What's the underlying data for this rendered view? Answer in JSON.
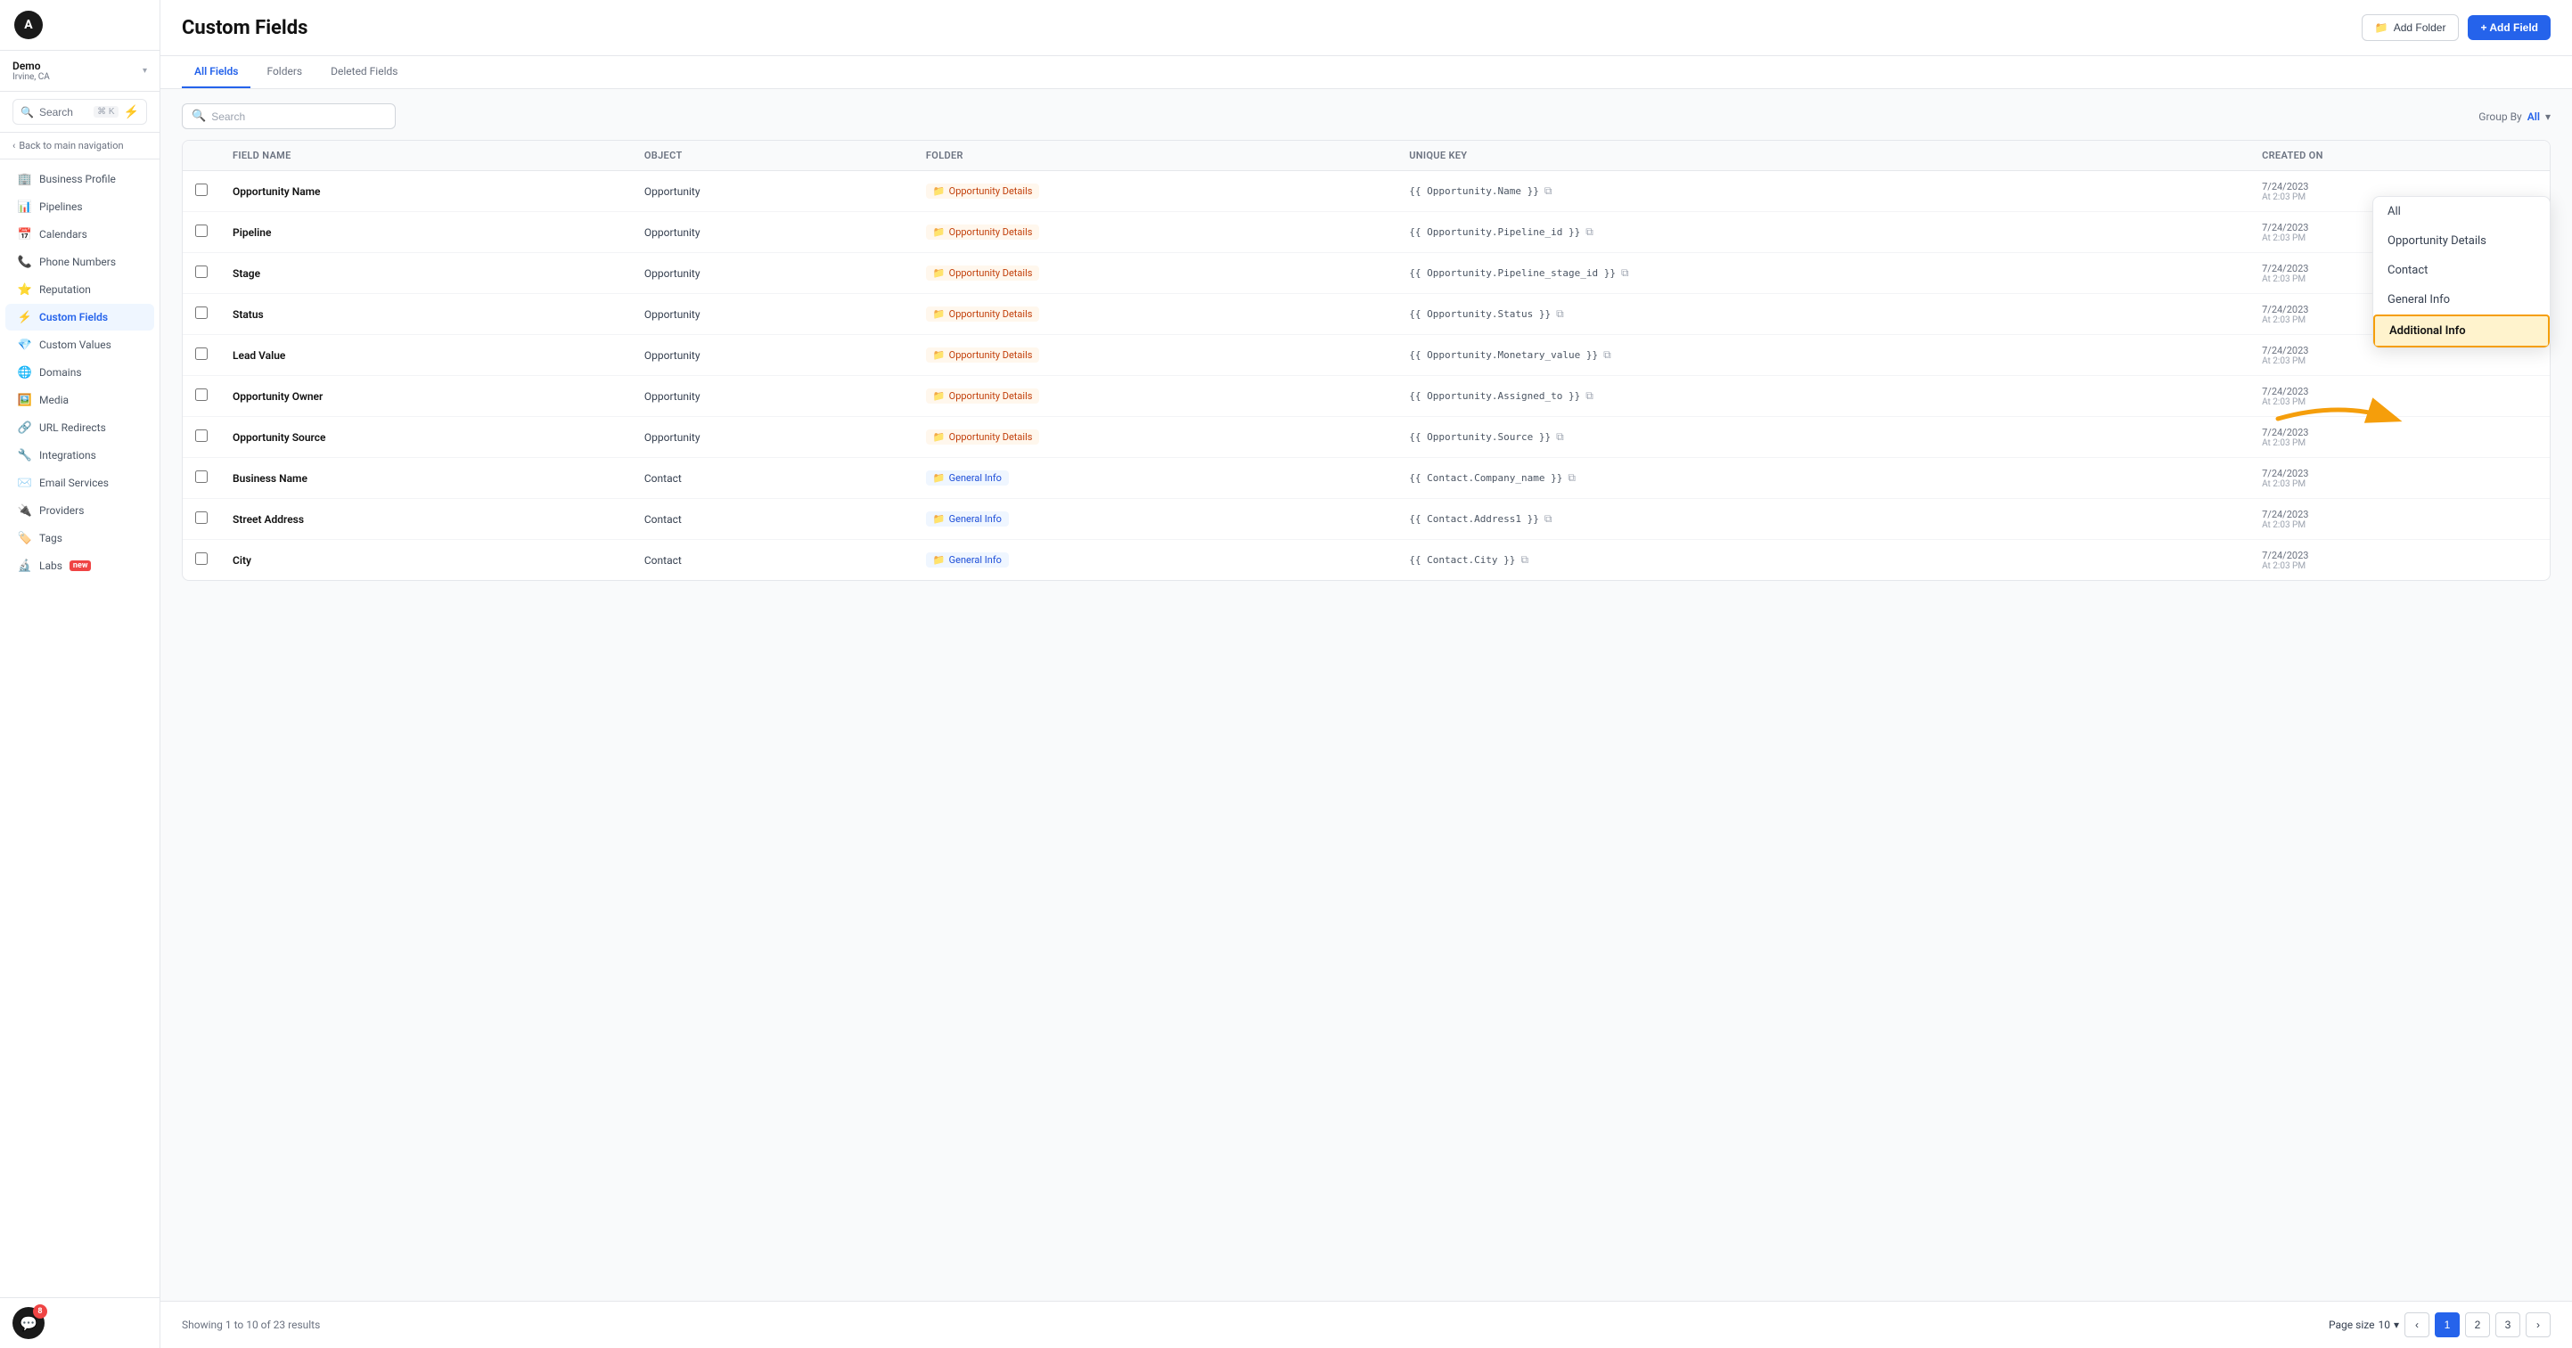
{
  "app": {
    "title": "Custom Fields"
  },
  "sidebar": {
    "logo_letter": "A",
    "user": {
      "name": "Demo",
      "location": "Irvine, CA"
    },
    "search_label": "Search",
    "search_shortcut": "⌘ K",
    "back_label": "Back to main navigation",
    "nav_items": [
      {
        "id": "business-profile",
        "label": "Business Profile",
        "icon": "🏢",
        "active": false
      },
      {
        "id": "pipelines",
        "label": "Pipelines",
        "icon": "📊",
        "active": false
      },
      {
        "id": "calendars",
        "label": "Calendars",
        "icon": "📅",
        "active": false
      },
      {
        "id": "phone-numbers",
        "label": "Phone Numbers",
        "icon": "📞",
        "active": false
      },
      {
        "id": "reputation",
        "label": "Reputation",
        "icon": "⭐",
        "active": false
      },
      {
        "id": "custom-fields",
        "label": "Custom Fields",
        "icon": "⚡",
        "active": true
      },
      {
        "id": "custom-values",
        "label": "Custom Values",
        "icon": "💎",
        "active": false
      },
      {
        "id": "domains",
        "label": "Domains",
        "icon": "🌐",
        "active": false
      },
      {
        "id": "media",
        "label": "Media",
        "icon": "🖼️",
        "active": false
      },
      {
        "id": "url-redirects",
        "label": "URL Redirects",
        "icon": "🔗",
        "active": false
      },
      {
        "id": "integrations",
        "label": "Integrations",
        "icon": "🔧",
        "active": false
      },
      {
        "id": "email-services",
        "label": "Email Services",
        "icon": "✉️",
        "active": false
      },
      {
        "id": "providers",
        "label": "Providers",
        "icon": "🔌",
        "active": false
      },
      {
        "id": "tags",
        "label": "Tags",
        "icon": "🏷️",
        "active": false
      },
      {
        "id": "labs",
        "label": "Labs",
        "icon": "🔬",
        "active": false,
        "badge": "new"
      }
    ],
    "chat_badge": "8"
  },
  "tabs": [
    {
      "id": "all-fields",
      "label": "All Fields",
      "active": true
    },
    {
      "id": "folders",
      "label": "Folders",
      "active": false
    },
    {
      "id": "deleted-fields",
      "label": "Deleted Fields",
      "active": false
    }
  ],
  "toolbar": {
    "search_placeholder": "Search",
    "group_by_label": "Group By",
    "group_by_value": "All",
    "add_folder_label": "Add Folder",
    "add_field_label": "+ Add Field"
  },
  "table": {
    "headers": [
      {
        "id": "checkbox",
        "label": ""
      },
      {
        "id": "field-name",
        "label": "Field Name"
      },
      {
        "id": "object",
        "label": "Object"
      },
      {
        "id": "folder",
        "label": "Folder"
      },
      {
        "id": "unique-key",
        "label": "Unique Key"
      },
      {
        "id": "created-on",
        "label": "Created On"
      }
    ],
    "rows": [
      {
        "field_name": "Opportunity Name",
        "object": "Opportunity",
        "folder": "Opportunity Details",
        "folder_type": "orange",
        "unique_key": "{{ Opportunity.Name }}",
        "created_date": "7/24/2023",
        "created_time": "At 2:03 PM"
      },
      {
        "field_name": "Pipeline",
        "object": "Opportunity",
        "folder": "Opportunity Details",
        "folder_type": "orange",
        "unique_key": "{{ Opportunity.Pipeline_id }}",
        "created_date": "7/24/2023",
        "created_time": "At 2:03 PM"
      },
      {
        "field_name": "Stage",
        "object": "Opportunity",
        "folder": "Opportunity Details",
        "folder_type": "orange",
        "unique_key": "{{ Opportunity.Pipeline_stage_id }}",
        "created_date": "7/24/2023",
        "created_time": "At 2:03 PM"
      },
      {
        "field_name": "Status",
        "object": "Opportunity",
        "folder": "Opportunity Details",
        "folder_type": "orange",
        "unique_key": "{{ Opportunity.Status }}",
        "created_date": "7/24/2023",
        "created_time": "At 2:03 PM"
      },
      {
        "field_name": "Lead Value",
        "object": "Opportunity",
        "folder": "Opportunity Details",
        "folder_type": "orange",
        "unique_key": "{{ Opportunity.Monetary_value }}",
        "created_date": "7/24/2023",
        "created_time": "At 2:03 PM"
      },
      {
        "field_name": "Opportunity Owner",
        "object": "Opportunity",
        "folder": "Opportunity Details",
        "folder_type": "orange",
        "unique_key": "{{ Opportunity.Assigned_to }}",
        "created_date": "7/24/2023",
        "created_time": "At 2:03 PM"
      },
      {
        "field_name": "Opportunity Source",
        "object": "Opportunity",
        "folder": "Opportunity Details",
        "folder_type": "orange",
        "unique_key": "{{ Opportunity.Source }}",
        "created_date": "7/24/2023",
        "created_time": "At 2:03 PM"
      },
      {
        "field_name": "Business Name",
        "object": "Contact",
        "folder": "General Info",
        "folder_type": "blue",
        "unique_key": "{{ Contact.Company_name }}",
        "created_date": "7/24/2023",
        "created_time": "At 2:03 PM"
      },
      {
        "field_name": "Street Address",
        "object": "Contact",
        "folder": "General Info",
        "folder_type": "blue",
        "unique_key": "{{ Contact.Address1 }}",
        "created_date": "7/24/2023",
        "created_time": "At 2:03 PM"
      },
      {
        "field_name": "City",
        "object": "Contact",
        "folder": "General Info",
        "folder_type": "blue",
        "unique_key": "{{ Contact.City }}",
        "created_date": "7/24/2023",
        "created_time": "At 2:03 PM"
      }
    ]
  },
  "pagination": {
    "info": "Showing 1 to 10 of 23 results",
    "page_size": "10",
    "current_page": 1,
    "total_pages": 3
  },
  "dropdown": {
    "items": [
      {
        "id": "all",
        "label": "All"
      },
      {
        "id": "opportunity-details",
        "label": "Opportunity Details"
      },
      {
        "id": "contact",
        "label": "Contact"
      },
      {
        "id": "general-info",
        "label": "General Info"
      },
      {
        "id": "additional-info",
        "label": "Additional Info",
        "highlighted": true
      }
    ]
  }
}
